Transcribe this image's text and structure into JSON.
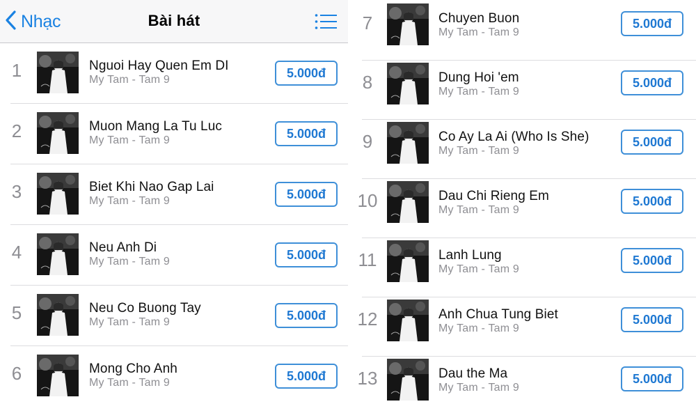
{
  "nav": {
    "back_label": "Nhạc",
    "title": "Bài hát"
  },
  "colors": {
    "accent": "#1a82e2",
    "price_border": "#3e8fd8",
    "secondary_text": "#8e8e93",
    "separator": "#dcdcdf"
  },
  "icons": {
    "back": "chevron-left-icon",
    "list": "list-icon",
    "cover": "album-cover-icon"
  },
  "songs_left": [
    {
      "rank": "1",
      "title": "Nguoi Hay Quen Em DI",
      "artist_album": "My Tam - Tam 9",
      "price": "5.000đ"
    },
    {
      "rank": "2",
      "title": "Muon Mang La Tu Luc",
      "artist_album": "My Tam - Tam 9",
      "price": "5.000đ"
    },
    {
      "rank": "3",
      "title": "Biet Khi Nao Gap Lai",
      "artist_album": "My Tam - Tam 9",
      "price": "5.000đ"
    },
    {
      "rank": "4",
      "title": "Neu Anh Di",
      "artist_album": "My Tam - Tam 9",
      "price": "5.000đ"
    },
    {
      "rank": "5",
      "title": "Neu Co Buong Tay",
      "artist_album": "My Tam - Tam 9",
      "price": "5.000đ"
    },
    {
      "rank": "6",
      "title": "Mong Cho Anh",
      "artist_album": "My Tam - Tam 9",
      "price": "5.000đ"
    }
  ],
  "songs_right": [
    {
      "rank": "7",
      "title": "Chuyen Buon",
      "artist_album": "My Tam - Tam 9",
      "price": "5.000đ"
    },
    {
      "rank": "8",
      "title": "Dung Hoi 'em",
      "artist_album": "My Tam - Tam 9",
      "price": "5.000đ"
    },
    {
      "rank": "9",
      "title": "Co Ay La Ai (Who Is She)",
      "artist_album": "My Tam - Tam 9",
      "price": "5.000đ"
    },
    {
      "rank": "10",
      "title": "Dau Chi Rieng Em",
      "artist_album": "My Tam - Tam 9",
      "price": "5.000đ"
    },
    {
      "rank": "11",
      "title": "Lanh Lung",
      "artist_album": "My Tam - Tam 9",
      "price": "5.000đ"
    },
    {
      "rank": "12",
      "title": "Anh Chua Tung Biet",
      "artist_album": "My Tam - Tam 9",
      "price": "5.000đ"
    },
    {
      "rank": "13",
      "title": "Dau the Ma",
      "artist_album": "My Tam - Tam 9",
      "price": "5.000đ"
    }
  ]
}
